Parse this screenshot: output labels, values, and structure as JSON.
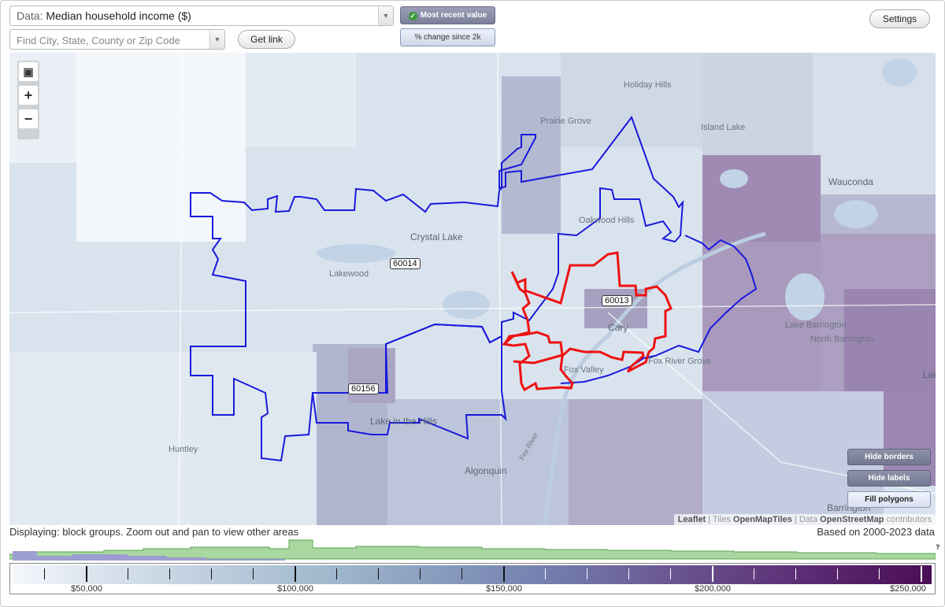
{
  "data_select": {
    "prefix": "Data:",
    "value": "Median household income ($)",
    "dropdown_icon": "chevron-down-icon"
  },
  "search": {
    "placeholder": "Find City, State, County or Zip Code",
    "dropdown_icon": "chevron-down-icon"
  },
  "buttons": {
    "get_link": "Get link",
    "settings": "Settings",
    "most_recent": "Most recent value",
    "pct_change": "% change since 2k"
  },
  "map": {
    "zoom_controls": {
      "fit": "fit-bounds-icon",
      "in": "+",
      "out": "−"
    },
    "places": [
      "Holiday Hills",
      "Prairie Grove",
      "Island Lake",
      "Wauconda",
      "Oakwood Hills",
      "Crystal Lake",
      "Lakewood",
      "Cary",
      "Fox River Grove",
      "Lake Barrington",
      "North Barrington",
      "Lake in the Hills",
      "Huntley",
      "Algonquin",
      "Barrington",
      "Lak",
      "Fox Valley",
      "Fox River"
    ],
    "zip_labels": [
      "60014",
      "60013",
      "60156"
    ],
    "map_buttons": {
      "hide_borders": "Hide borders",
      "hide_labels": "Hide labels",
      "fill_polygons": "Fill polygons"
    },
    "attribution": {
      "leaflet": "Leaflet",
      "sep1": "| Tiles",
      "tiles": "OpenMapTiles",
      "sep2": "| Data",
      "data": "OpenStreetMap",
      "suffix": "contributors"
    },
    "border_colors": {
      "zip_60013": "#ee1111",
      "other_zips": "#1a1adc"
    }
  },
  "status": {
    "displaying": "Displaying: block groups. Zoom out and pan to view other areas",
    "based_on": "Based on 2000-2023 data",
    "histogram_help": "?"
  },
  "legend": {
    "labels": [
      "$50,000",
      "$100,000",
      "$150,000",
      "$200,000",
      "$250,000"
    ],
    "colors": {
      "low": "#f4f6fb",
      "mid": "#7482b0",
      "high": "#4a0e55"
    }
  }
}
